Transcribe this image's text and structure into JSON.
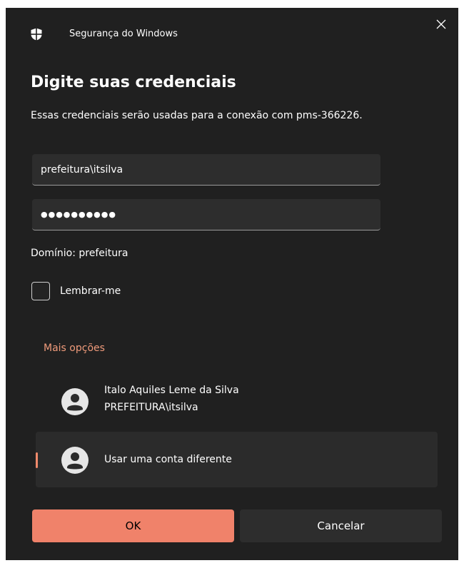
{
  "window": {
    "title": "Segurança do Windows",
    "icon": "shield-icon",
    "close_icon": "close-icon"
  },
  "dialog": {
    "heading": "Digite suas credenciais",
    "description": "Essas credenciais serão usadas para a conexão com pms-366226.",
    "username_value": "prefeitura\\itsilva",
    "password_masked": "●●●●●●●●●●",
    "domain_text": "Domínio: prefeitura",
    "remember_label": "Lembrar-me",
    "remember_checked": false,
    "more_options_label": "Mais opções"
  },
  "accounts": [
    {
      "name": "Italo Aquiles Leme da Silva",
      "username": "PREFEITURA\\itsilva",
      "selected": false
    },
    {
      "name": "Usar uma conta diferente",
      "selected": true
    }
  ],
  "buttons": {
    "ok_label": "OK",
    "cancel_label": "Cancelar"
  },
  "colors": {
    "accent": "#f0826a",
    "link": "#f09b7b",
    "background": "#202020"
  }
}
